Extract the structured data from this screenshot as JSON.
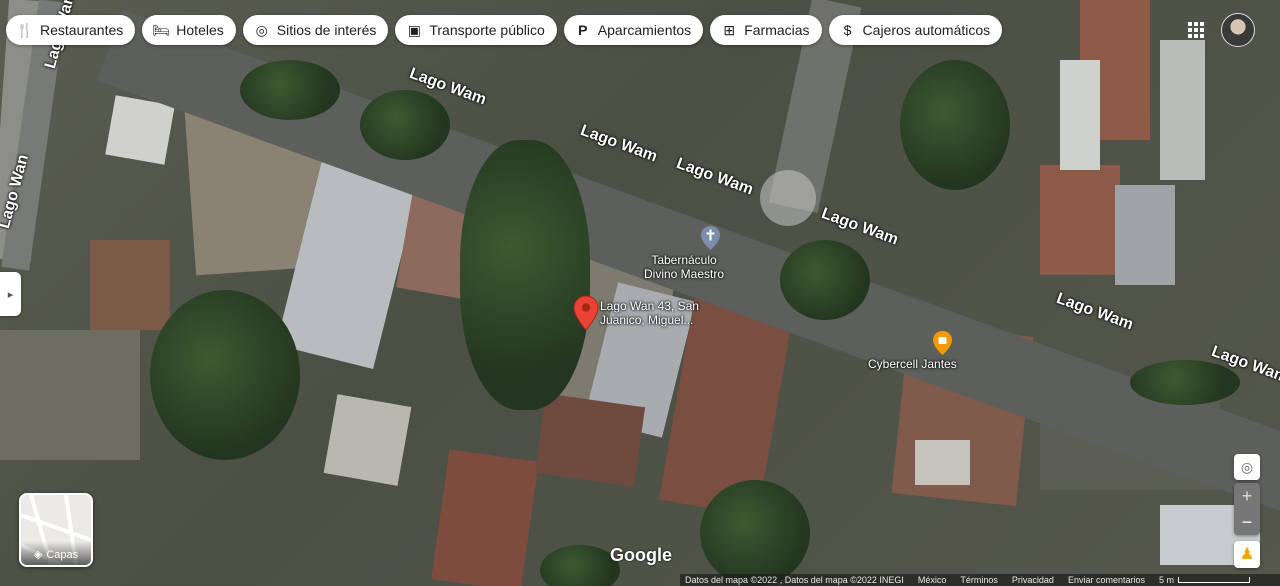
{
  "top_chips": [
    {
      "label": "Restaurantes",
      "icon": "fork-knife-icon"
    },
    {
      "label": "Hoteles",
      "icon": "bed-icon"
    },
    {
      "label": "Sitios de interés",
      "icon": "camera-icon"
    },
    {
      "label": "Transporte público",
      "icon": "bus-icon"
    },
    {
      "label": "Aparcamientos",
      "icon": "parking-icon"
    },
    {
      "label": "Farmacias",
      "icon": "pharmacy-icon"
    },
    {
      "label": "Cajeros automáticos",
      "icon": "atm-icon"
    }
  ],
  "street_labels": {
    "a": "Lago Wam",
    "b": "Lago Wam",
    "c": "Lago Wam",
    "d": "Lago Wam",
    "e": "Lago Wam",
    "f": "Lago Wam",
    "g": "Lago Wam",
    "h": "Lago Wan"
  },
  "pin": {
    "label_line1": "Lago Wan 43, San",
    "label_line2": "Juanico, Miguel..."
  },
  "pois": {
    "church_line1": "Tabernáculo",
    "church_line2": "Divino Maestro",
    "shop": "Cybercell Jantes"
  },
  "layers_label": "Capas",
  "brand": "Google",
  "footer": {
    "map_data": "Datos del mapa ©2022 , Datos del mapa ©2022 INEGI",
    "country": "México",
    "terms": "Términos",
    "privacy": "Privacidad",
    "feedback": "Enviar comentarios",
    "scale": "5 m"
  },
  "colors": {
    "pin": "#ea4335",
    "poi_orange": "#f29900",
    "chip_bg": "#ffffff"
  }
}
